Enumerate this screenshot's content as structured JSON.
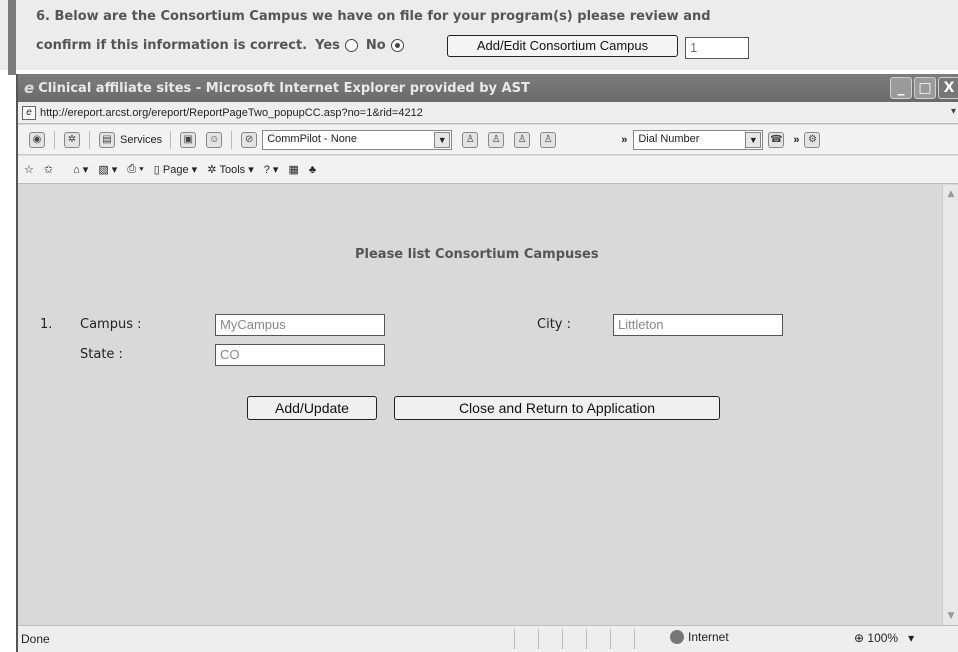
{
  "background_page": {
    "question_line1": "6. Below are the Consortium Campus we have on file for your program(s) please review and",
    "question_line2": "confirm if this information is correct.",
    "yes_label": "Yes",
    "no_label": "No",
    "selected": "No",
    "edit_button_label": "Add/Edit Consortium Campus",
    "count_value": "1"
  },
  "window": {
    "title": "Clinical affiliate sites - Microsoft Internet Explorer provided by AST",
    "url": "http://ereport.arcst.org/ereport/ReportPageTwo_popupCC.asp?no=1&rid=4212",
    "toolbar1": {
      "services_label": "Services",
      "commpilot_value": "CommPilot - None",
      "chevron": "»",
      "dial_number_value": "Dial Number"
    },
    "toolbar2": {
      "page_label": "Page",
      "tools_label": "Tools"
    },
    "controls": {
      "minimize": "_",
      "maximize": "□",
      "close": "X"
    }
  },
  "form": {
    "heading": "Please list Consortium Campuses",
    "row_number": "1.",
    "campus_label": "Campus :",
    "campus_value": "MyCampus",
    "city_label": "City :",
    "city_value": "Littleton",
    "state_label": "State :",
    "state_value": "CO",
    "add_update_label": "Add/Update",
    "close_return_label": "Close and Return to Application"
  },
  "statusbar": {
    "status": "Done",
    "zone": "Internet",
    "zoom": "100%"
  },
  "colors": {
    "titlebar": "#707070",
    "content_bg": "#d9d9d9",
    "field_text": "#888888"
  }
}
